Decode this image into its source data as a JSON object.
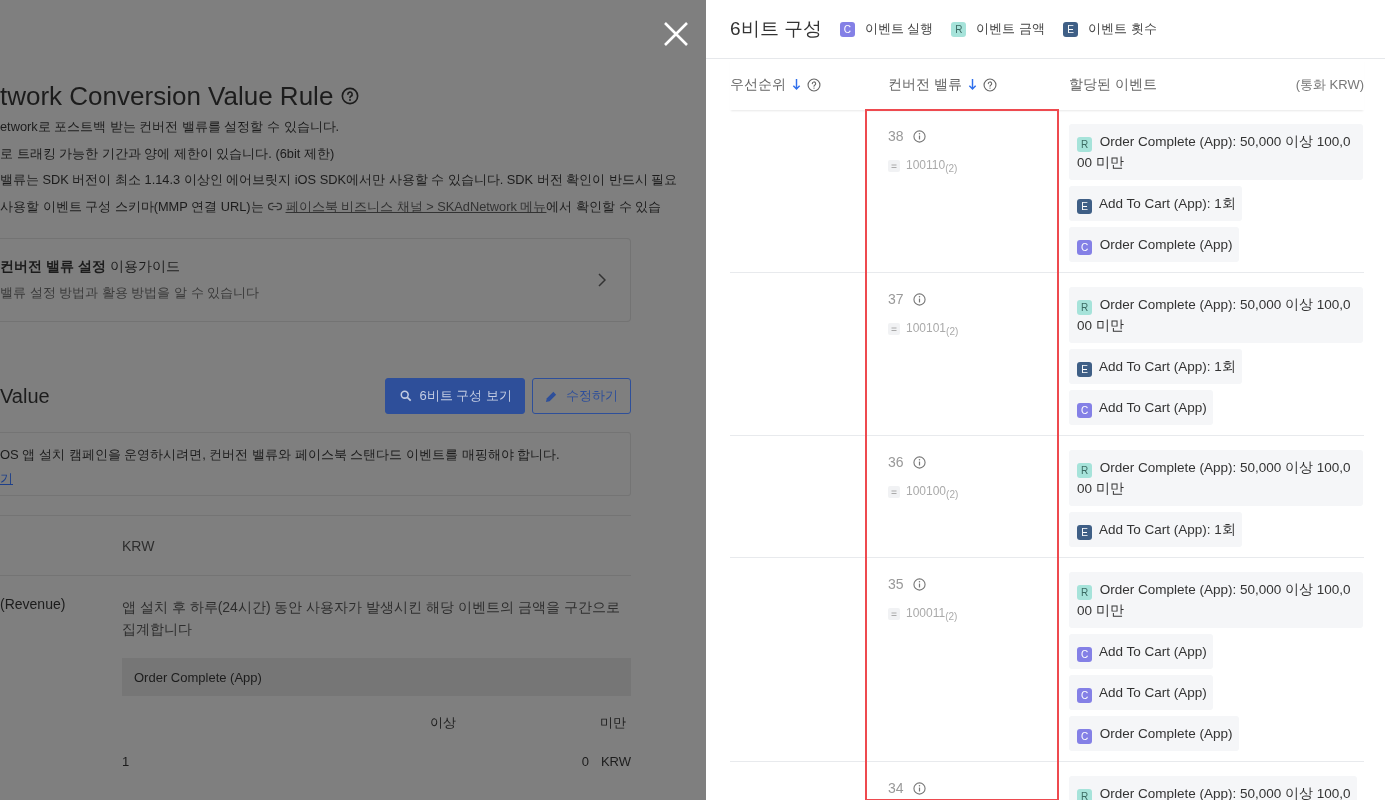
{
  "page": {
    "title": "twork Conversion Value Rule",
    "description": [
      "etwork로 포스트백 받는 컨버전 밸류를 설정할 수 있습니다.",
      "로 트래킹 가능한 기간과 양에 제한이 있습니다. (6bit 제한)",
      "밸류는 SDK 버전이 최소 1.14.3 이상인 에어브릿지 iOS SDK에서만 사용할 수 있습니다. SDK 버전 확인이 반드시 필요"
    ],
    "link_line": {
      "before": "사용할 이벤트 구성 스키마(MMP 연결 URL)는",
      "link": "페이스북 비즈니스 채널 > SKAdNetwork 메뉴",
      "after": "에서 확인할 수 있습"
    },
    "guide_card": {
      "title": "**컨버전 밸류 설정** 이용가이드",
      "subtitle": "밸류 설정 방법과 활용 방법을 알 수 있습니다"
    },
    "section_title": "Value",
    "buttons": [
      {
        "label": "6비트 구성 보기",
        "kind": "primary"
      },
      {
        "label": "수정하기",
        "kind": "outline"
      }
    ],
    "notice": {
      "text": "OS 앱 설치 캠페인을 운영하시려면, 컨버전 밸류와 페이스북 스탠다드 이벤트를 매핑해야 합니다.",
      "link": "기"
    },
    "currency_row": {
      "value": "KRW"
    },
    "revenue_row": {
      "label": "(Revenue)",
      "description": "앱 설치 후 하루(24시간) 동안 사용자가 발생시킨 해당 이벤트의 금액을 구간으로 집계합니다",
      "event": "Order Complete (App)",
      "headers": [
        "이상",
        "미만"
      ],
      "range": {
        "index": "1",
        "value": "0",
        "unit": "KRW"
      }
    }
  },
  "panel": {
    "title": "6비트 구성",
    "legend": [
      {
        "badge": "C",
        "label": "이벤트 실행",
        "kind": "execution"
      },
      {
        "badge": "R",
        "label": "이벤트 금액",
        "kind": "revenue"
      },
      {
        "badge": "E",
        "label": "이벤트 횟수",
        "kind": "count"
      }
    ],
    "columns": [
      "우선순위",
      "컨버전 밸류",
      "할당된 이벤트"
    ],
    "currency_note": "(통화 KRW)",
    "rows": [
      {
        "value": "38",
        "binary": "100110$_{(2)}$",
        "events": [
          {
            "badge": "R",
            "kind": "revenue",
            "text": "Order Complete (App): 50,000 이상 100,000 미만"
          },
          {
            "badge": "E",
            "kind": "count",
            "text": "Add To Cart (App): 1회"
          },
          {
            "badge": "C",
            "kind": "execution",
            "text": "Order Complete (App)"
          }
        ]
      },
      {
        "value": "37",
        "binary": "100101$_{(2)}$",
        "events": [
          {
            "badge": "R",
            "kind": "revenue",
            "text": "Order Complete (App): 50,000 이상 100,000 미만"
          },
          {
            "badge": "E",
            "kind": "count",
            "text": "Add To Cart (App): 1회"
          },
          {
            "badge": "C",
            "kind": "execution",
            "text": "Add To Cart (App)"
          }
        ]
      },
      {
        "value": "36",
        "binary": "100100$_{(2)}$",
        "events": [
          {
            "badge": "R",
            "kind": "revenue",
            "text": "Order Complete (App): 50,000 이상 100,000 미만"
          },
          {
            "badge": "E",
            "kind": "count",
            "text": "Add To Cart (App): 1회"
          }
        ]
      },
      {
        "value": "35",
        "binary": "100011$_{(2)}$",
        "events": [
          {
            "badge": "R",
            "kind": "revenue",
            "text": "Order Complete (App): 50,000 이상 100,000 미만"
          },
          {
            "badge": "C",
            "kind": "execution",
            "text": "Add To Cart (App)"
          },
          {
            "badge": "C",
            "kind": "execution",
            "text": "Add To Cart (App)"
          },
          {
            "badge": "C",
            "kind": "execution",
            "text": "Order Complete (App)"
          }
        ]
      },
      {
        "value": "34",
        "events": [
          {
            "badge": "R",
            "kind": "revenue",
            "text": "Order Complete (App): 50,000 이상 100,0"
          }
        ]
      }
    ]
  }
}
